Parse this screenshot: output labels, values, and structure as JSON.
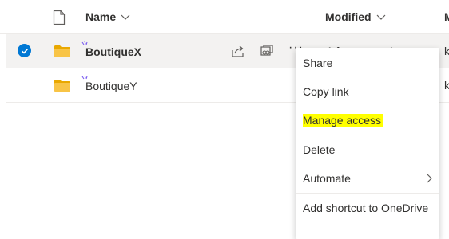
{
  "header": {
    "name_label": "Name",
    "modified_label": "Modified",
    "extra_col_label": "M"
  },
  "rows": [
    {
      "name": "BoutiqueX",
      "selected": true,
      "modified": "A few seconds ago",
      "extra": "k",
      "icons": [
        "folder-icon",
        "share-icon",
        "copy-link-icon",
        "more-icon"
      ]
    },
    {
      "name": "BoutiqueY",
      "selected": false,
      "modified": "",
      "extra": "k",
      "icons": [
        "folder-icon"
      ]
    }
  ],
  "context_menu": {
    "items": [
      {
        "label": "Share"
      },
      {
        "label": "Copy link"
      },
      {
        "label": "Manage access",
        "highlighted": true
      },
      {
        "label": "Delete"
      },
      {
        "label": "Automate",
        "has_submenu": true
      },
      {
        "label": "Add shortcut to OneDrive"
      }
    ]
  },
  "more_glyph": "···",
  "colors": {
    "accent": "#0078d4",
    "folder": "#f8c446",
    "selected_row": "#f3f2f1",
    "highlight": "#ffff00",
    "text": "#323130"
  }
}
